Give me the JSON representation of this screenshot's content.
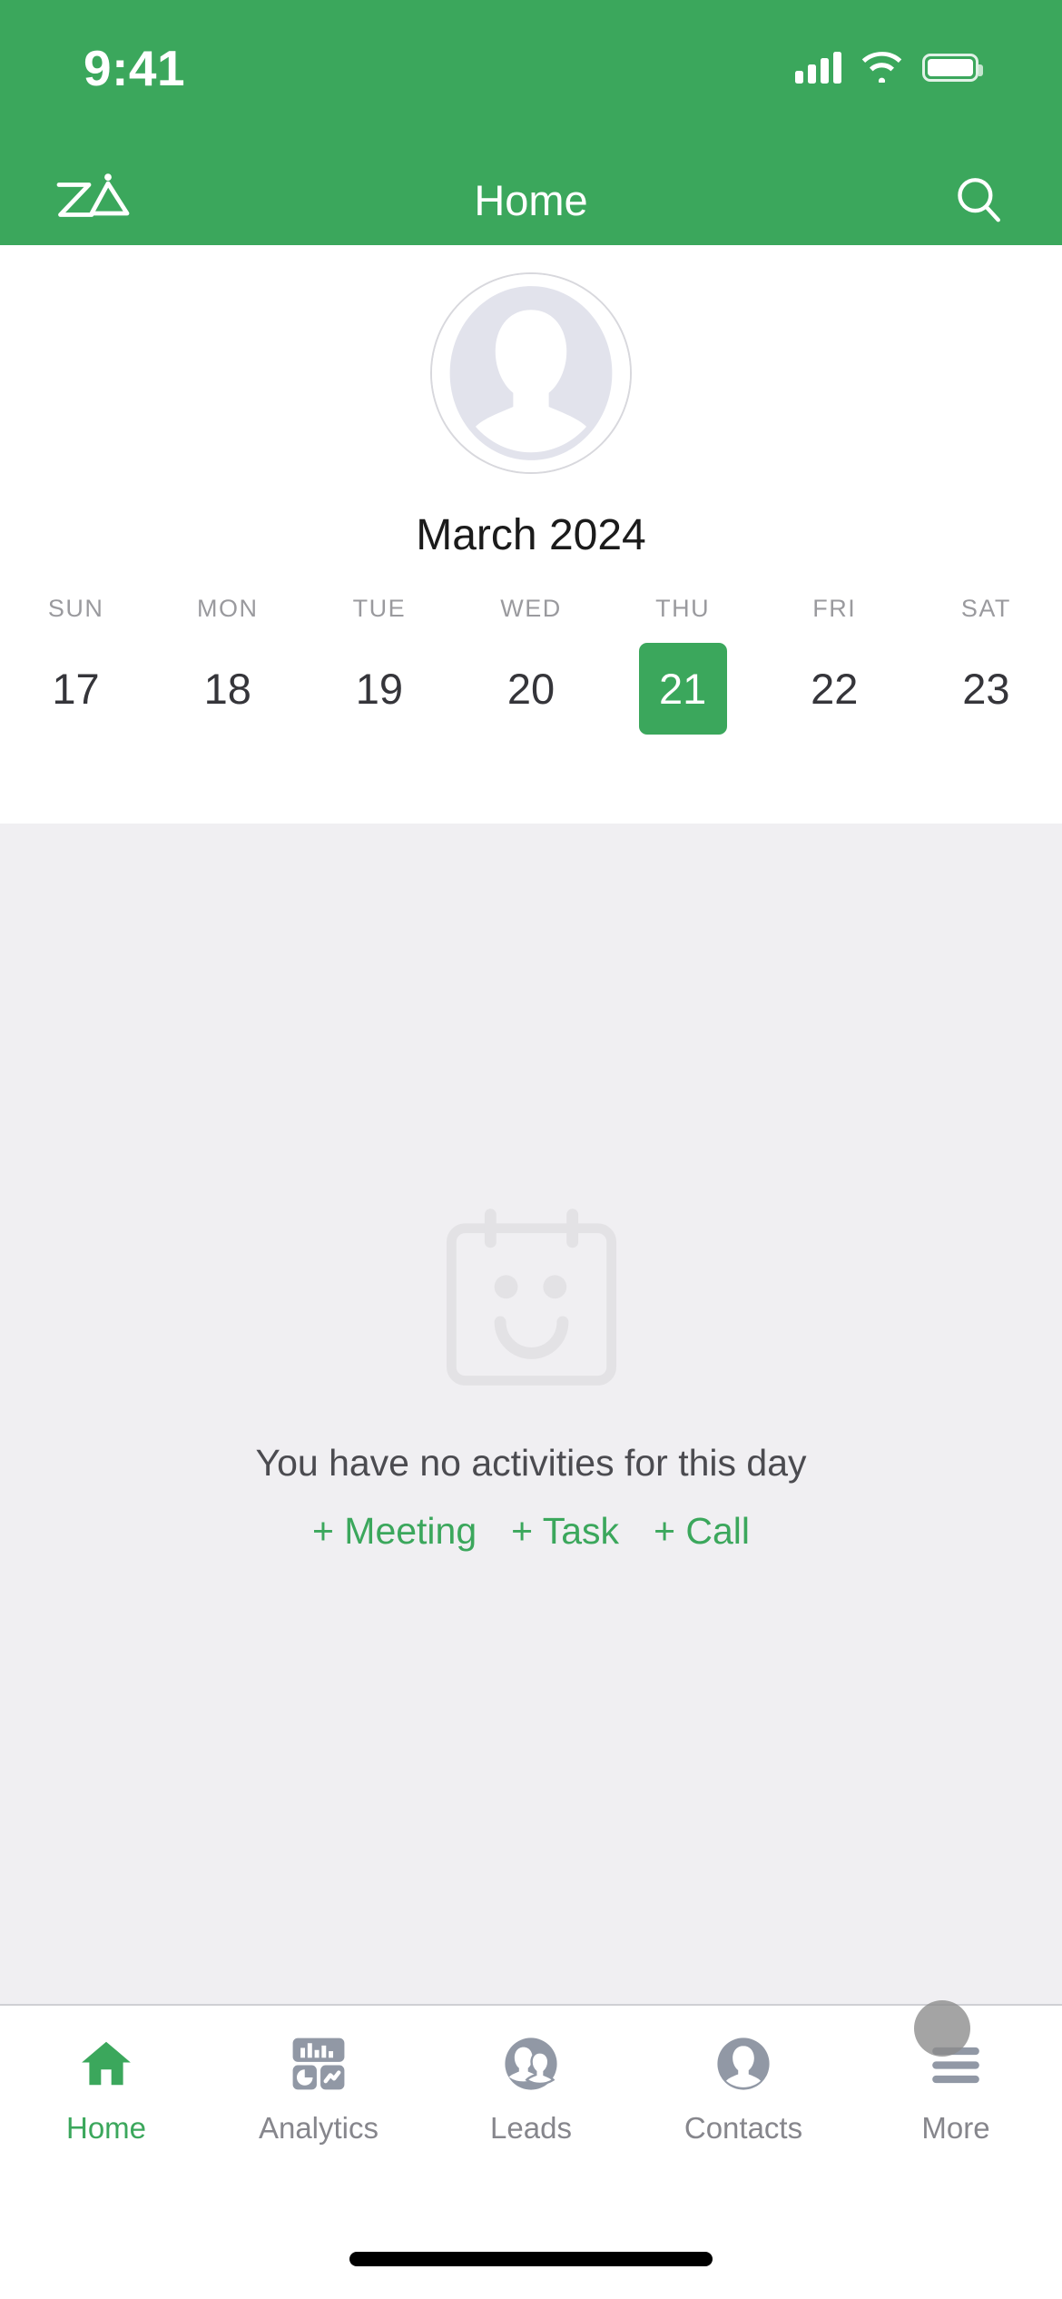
{
  "theme": {
    "brand": "#3BA75C",
    "content_bg": "#f0eff2",
    "muted": "#9a9a9e"
  },
  "status_bar": {
    "time": "9:41",
    "signal_icon": "cellular-signal-icon",
    "wifi_icon": "wifi-icon",
    "battery_icon": "battery-icon"
  },
  "nav_bar": {
    "logo_name": "zia-logo",
    "title": "Home",
    "search_icon": "search-icon"
  },
  "profile": {
    "avatar_name": "user-avatar-placeholder"
  },
  "calendar": {
    "month_label": "March 2024",
    "days": [
      {
        "dow": "SUN",
        "date": "17",
        "selected": false
      },
      {
        "dow": "MON",
        "date": "18",
        "selected": false
      },
      {
        "dow": "TUE",
        "date": "19",
        "selected": false
      },
      {
        "dow": "WED",
        "date": "20",
        "selected": false
      },
      {
        "dow": "THU",
        "date": "21",
        "selected": true
      },
      {
        "dow": "FRI",
        "date": "22",
        "selected": false
      },
      {
        "dow": "SAT",
        "date": "23",
        "selected": false
      }
    ]
  },
  "empty_state": {
    "illustration_name": "calendar-smiley-icon",
    "message": "You have no activities for this day",
    "actions": [
      {
        "label": "+ Meeting",
        "name": "add-meeting-link"
      },
      {
        "label": "+ Task",
        "name": "add-task-link"
      },
      {
        "label": "+ Call",
        "name": "add-call-link"
      }
    ]
  },
  "tab_bar": {
    "tabs": [
      {
        "label": "Home",
        "icon": "home-icon",
        "active": true
      },
      {
        "label": "Analytics",
        "icon": "analytics-dashboard-icon",
        "active": false
      },
      {
        "label": "Leads",
        "icon": "two-people-icon",
        "active": false
      },
      {
        "label": "Contacts",
        "icon": "person-icon",
        "active": false
      },
      {
        "label": "More",
        "icon": "hamburger-menu-icon",
        "active": false
      }
    ]
  },
  "system": {
    "home_indicator": "home-indicator"
  }
}
